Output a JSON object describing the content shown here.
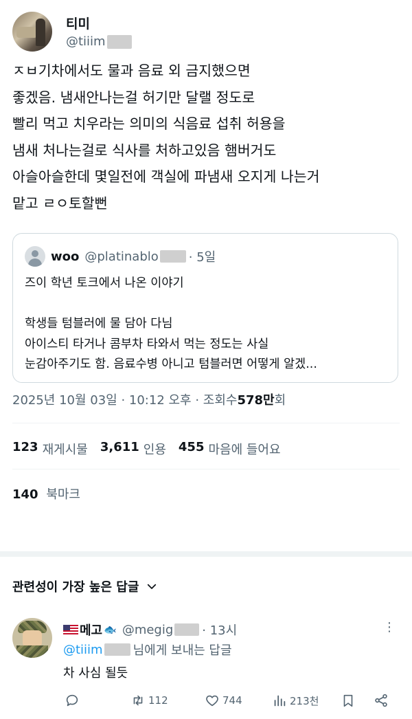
{
  "author": {
    "name": "티미",
    "handle": "@tiiim"
  },
  "tweet": {
    "lines": [
      "ㅈㅂ기차에서도 물과 음료 외 금지했으면",
      "좋겠음. 냄새안나는걸 허기만 달랠 정도로",
      "빨리 먹고 치우라는 의미의 식음료 섭취 허용을",
      "냄새 처나는걸로 식사를 처하고있음 햄버거도",
      "아슬아슬한데 몇일전에 객실에 파냄새 오지게 나는거",
      "맡고 ㄹㅇ토할뻔"
    ]
  },
  "quote": {
    "name": "woo",
    "handle": "@platinablo",
    "time": "· 5일",
    "lines": [
      "즈이 학년 토크에서 나온 이야기",
      "",
      "학생들 텀블러에 물 담아 다님",
      "아이스티 타거나 콤부차 타와서 먹는 정도는 사실",
      "눈감아주기도 함. 음료수병 아니고 텀블러면 어떻게 알겠..."
    ]
  },
  "meta": {
    "datetime": "2025년 10월 03일 · 10:12 오후 · 조회수 ",
    "views": "578만",
    "views_suffix": "회"
  },
  "stats": {
    "reposts": "123",
    "reposts_label": "재게시물",
    "quotes": "3,611",
    "quotes_label": "인용",
    "likes": "455",
    "likes_label": "마음에 들어요",
    "bookmarks": "140",
    "bookmarks_label": "북마크"
  },
  "replies_sort": {
    "label": "관련성이 가장 높은 답글"
  },
  "reply": {
    "name": "메고",
    "handle": "@megig",
    "time": "· 13시",
    "reply_to": "@tiiim",
    "reply_to_suffix": "님에게 보내는 답글",
    "text": "차 사심 될듯",
    "actions": {
      "reply_count": "",
      "repost_count": "112",
      "like_count": "744",
      "views_count": "213천"
    }
  },
  "colors": {
    "accent": "#1d9bf0",
    "secondary_text": "#536471",
    "border": "#cfd9de"
  }
}
